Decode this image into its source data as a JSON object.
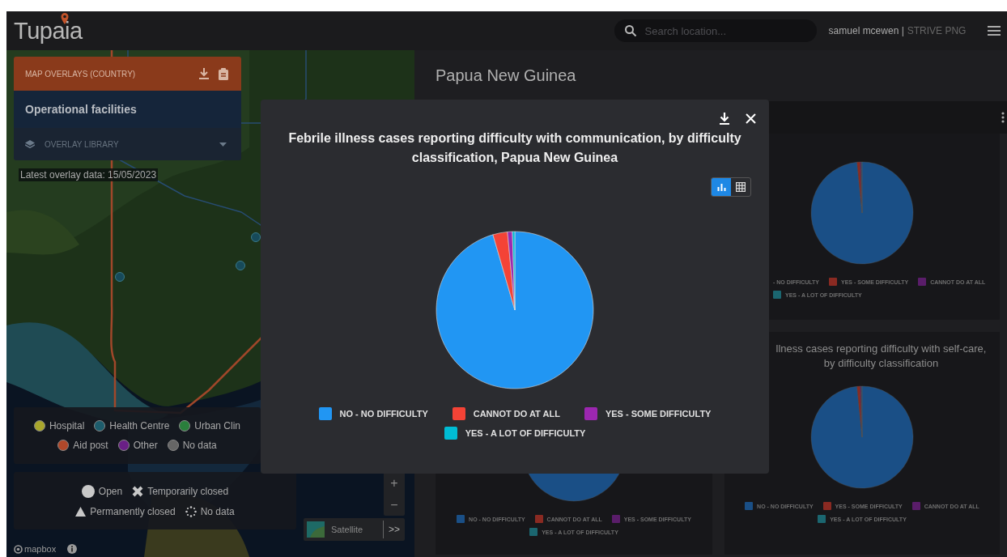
{
  "header": {
    "logo": "Tupaia",
    "search": {
      "placeholder": "Search location..."
    },
    "user": "samuel mcewen |",
    "project": "STRIVE PNG"
  },
  "map_panel": {
    "overlays": {
      "title": "MAP OVERLAYS (COUNTRY)",
      "selected_overlay": "Operational facilities",
      "library": "OVERLAY LIBRARY"
    },
    "latest_data": "Latest overlay data: 15/05/2023",
    "type_legend": [
      {
        "label": "Hospital",
        "color": "#a9a62c"
      },
      {
        "label": "Health Centre",
        "color": "#1d5c6c"
      },
      {
        "label": "Urban Clin",
        "color": "#2a7f3c"
      },
      {
        "label": "Aid post",
        "color": "#b0482a"
      },
      {
        "label": "Other",
        "color": "#6a1f86"
      },
      {
        "label": "No data",
        "color": "#666666"
      }
    ],
    "status_legend": [
      {
        "kind": "open",
        "label": "Open"
      },
      {
        "kind": "temporarily_closed",
        "label": "Temporarily closed"
      },
      {
        "kind": "permanently_closed",
        "label": "Permanently closed"
      },
      {
        "kind": "no_data",
        "label": "No data"
      }
    ],
    "zoom_in": "+",
    "zoom_out": "−",
    "basemap": {
      "label": "Satellite",
      "toggle": ">>"
    },
    "attribution": "mapbox"
  },
  "dashboard": {
    "title": "Papua New Guinea",
    "top_right_card": {
      "legend": [
        {
          "label": "- NO DIFFICULTY"
        },
        {
          "label": "YES - SOME DIFFICULTY",
          "color": "#8a2a22"
        },
        {
          "label": "CANNOT DO AT ALL",
          "color": "#5a1d6a"
        },
        {
          "label": "YES - A LOT OF DIFFICULTY",
          "color": "#1b6670"
        }
      ]
    },
    "bottom_left_card": {
      "legend": [
        {
          "label": "NO - NO DIFFICULTY",
          "color": "#1a4f86"
        },
        {
          "label": "CANNOT DO AT ALL",
          "color": "#8a2a22"
        },
        {
          "label": "YES - SOME DIFFICULTY",
          "color": "#5a1d6a"
        },
        {
          "label": "YES - A LOT OF DIFFICULTY",
          "color": "#1b6670"
        }
      ]
    },
    "bottom_right_card": {
      "title": "llness cases reporting difficulty with self-care, by difficulty classification",
      "legend": [
        {
          "label": "NO - NO DIFFICULTY",
          "color": "#1a4f86"
        },
        {
          "label": "YES - SOME DIFFICULTY",
          "color": "#8a2a22"
        },
        {
          "label": "CANNOT DO AT ALL",
          "color": "#5a1d6a"
        },
        {
          "label": "YES - A LOT OF DIFFICULTY",
          "color": "#1b6670"
        }
      ]
    }
  },
  "modal": {
    "title": "Febrile illness cases reporting difficulty with communication, by difficulty classification, Papua New Guinea",
    "view_toggle": [
      {
        "kind": "chart",
        "selected": true
      },
      {
        "kind": "table",
        "selected": false
      }
    ],
    "legend": [
      {
        "label": "NO - NO DIFFICULTY",
        "color": "#2196f3"
      },
      {
        "label": "CANNOT DO AT ALL",
        "color": "#f44336"
      },
      {
        "label": "YES - SOME DIFFICULTY",
        "color": "#9c27b0"
      },
      {
        "label": "YES - A LOT OF DIFFICULTY",
        "color": "#00bcd4"
      }
    ]
  }
}
